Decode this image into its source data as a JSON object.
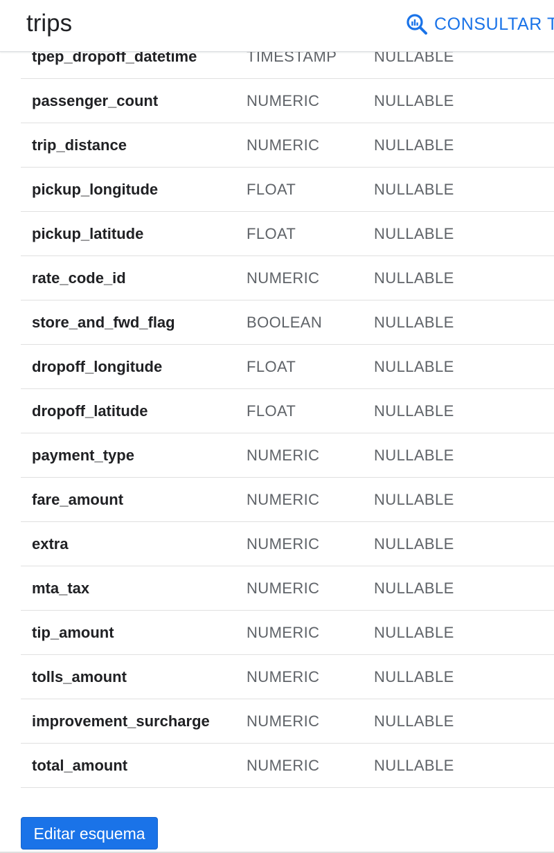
{
  "header": {
    "title": "trips",
    "query_button_label": "CONSULTAR TA"
  },
  "colors": {
    "accent": "#1a73e8",
    "text_primary": "#202124",
    "text_secondary": "#5f6368",
    "divider": "#e0e0e0"
  },
  "schema": {
    "fields": [
      {
        "name": "tpep_dropoff_datetime",
        "type": "TIMESTAMP",
        "mode": "NULLABLE"
      },
      {
        "name": "passenger_count",
        "type": "NUMERIC",
        "mode": "NULLABLE"
      },
      {
        "name": "trip_distance",
        "type": "NUMERIC",
        "mode": "NULLABLE"
      },
      {
        "name": "pickup_longitude",
        "type": "FLOAT",
        "mode": "NULLABLE"
      },
      {
        "name": "pickup_latitude",
        "type": "FLOAT",
        "mode": "NULLABLE"
      },
      {
        "name": "rate_code_id",
        "type": "NUMERIC",
        "mode": "NULLABLE"
      },
      {
        "name": "store_and_fwd_flag",
        "type": "BOOLEAN",
        "mode": "NULLABLE"
      },
      {
        "name": "dropoff_longitude",
        "type": "FLOAT",
        "mode": "NULLABLE"
      },
      {
        "name": "dropoff_latitude",
        "type": "FLOAT",
        "mode": "NULLABLE"
      },
      {
        "name": "payment_type",
        "type": "NUMERIC",
        "mode": "NULLABLE"
      },
      {
        "name": "fare_amount",
        "type": "NUMERIC",
        "mode": "NULLABLE"
      },
      {
        "name": "extra",
        "type": "NUMERIC",
        "mode": "NULLABLE"
      },
      {
        "name": "mta_tax",
        "type": "NUMERIC",
        "mode": "NULLABLE"
      },
      {
        "name": "tip_amount",
        "type": "NUMERIC",
        "mode": "NULLABLE"
      },
      {
        "name": "tolls_amount",
        "type": "NUMERIC",
        "mode": "NULLABLE"
      },
      {
        "name": "improvement_surcharge",
        "type": "NUMERIC",
        "mode": "NULLABLE"
      },
      {
        "name": "total_amount",
        "type": "NUMERIC",
        "mode": "NULLABLE"
      }
    ]
  },
  "footer": {
    "edit_schema_label": "Editar esquema"
  }
}
